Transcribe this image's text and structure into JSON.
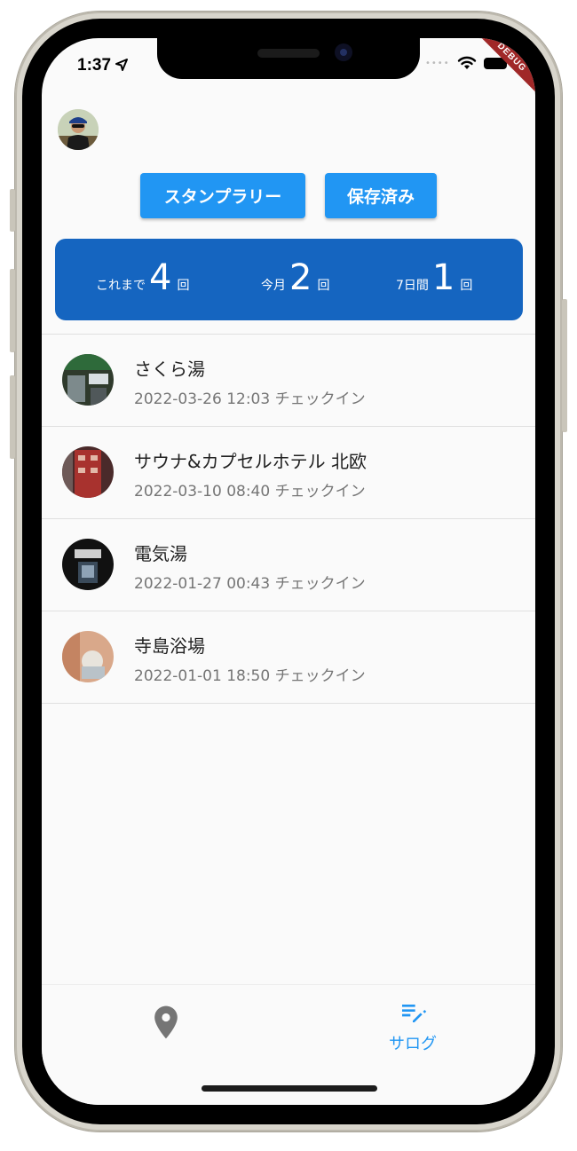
{
  "status_bar": {
    "time": "1:37",
    "debug_label": "DEBUG"
  },
  "buttons": {
    "stamp_rally": "スタンプラリー",
    "saved": "保存済み"
  },
  "stats": {
    "total": {
      "label": "これまで",
      "value": "4",
      "unit": "回"
    },
    "month": {
      "label": "今月",
      "value": "2",
      "unit": "回"
    },
    "week": {
      "label": "7日間",
      "value": "1",
      "unit": "回"
    }
  },
  "checkins": [
    {
      "name": "さくら湯",
      "datetime": "2022-03-26 12:03 チェックイン"
    },
    {
      "name": "サウナ&カプセルホテル 北欧",
      "datetime": "2022-03-10 08:40 チェックイン"
    },
    {
      "name": "電気湯",
      "datetime": "2022-01-27 00:43 チェックイン"
    },
    {
      "name": "寺島浴場",
      "datetime": "2022-01-01 18:50 チェックイン"
    }
  ],
  "bottom_nav": {
    "map_icon": "location-pin-icon",
    "log_icon": "edit-note-icon",
    "log_label": "サログ"
  },
  "colors": {
    "accent": "#2196f3",
    "card": "#1565c0"
  }
}
